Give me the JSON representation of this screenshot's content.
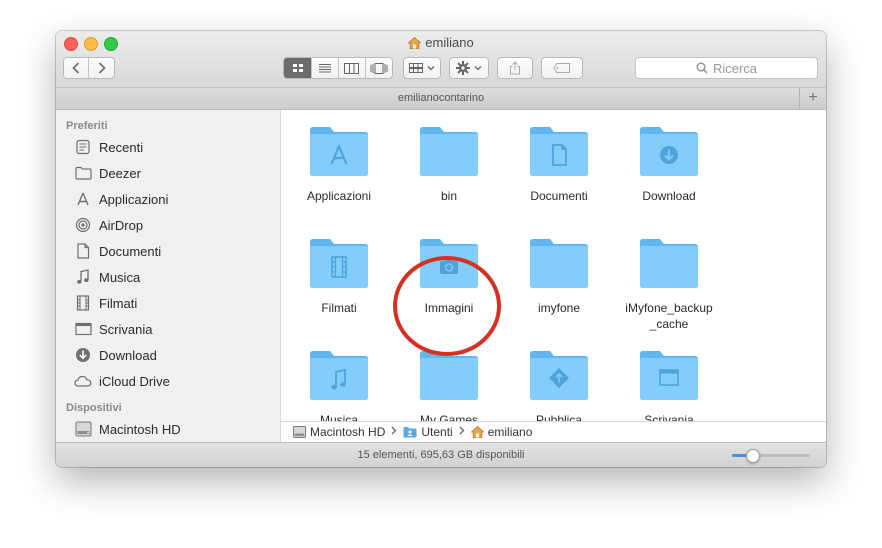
{
  "window": {
    "title": "emiliano",
    "path_header": "emilianocontarino"
  },
  "search": {
    "placeholder": "Ricerca"
  },
  "sidebar": {
    "favorites_header": "Preferiti",
    "favorites": [
      {
        "label": "Recenti",
        "icon": "clock-icon"
      },
      {
        "label": "Deezer",
        "icon": "folder-icon"
      },
      {
        "label": "Applicazioni",
        "icon": "applications-icon"
      },
      {
        "label": "AirDrop",
        "icon": "airdrop-icon"
      },
      {
        "label": "Documenti",
        "icon": "document-icon"
      },
      {
        "label": "Musica",
        "icon": "music-note-icon"
      },
      {
        "label": "Filmati",
        "icon": "film-icon"
      },
      {
        "label": "Scrivania",
        "icon": "desktop-icon"
      },
      {
        "label": "Download",
        "icon": "download-icon"
      },
      {
        "label": "iCloud Drive",
        "icon": "cloud-icon"
      }
    ],
    "devices_header": "Dispositivi",
    "devices": [
      {
        "label": "Macintosh HD",
        "icon": "hard-drive-icon"
      }
    ]
  },
  "files": [
    {
      "label": "Applicazioni",
      "icon": "applications-folder-icon"
    },
    {
      "label": "bin",
      "icon": "folder-icon"
    },
    {
      "label": "Documenti",
      "icon": "documents-folder-icon"
    },
    {
      "label": "Download",
      "icon": "downloads-folder-icon"
    },
    {
      "label": "Filmati",
      "icon": "movies-folder-icon"
    },
    {
      "label": "Immagini",
      "icon": "pictures-folder-icon"
    },
    {
      "label": "imyfone",
      "icon": "folder-icon"
    },
    {
      "label": "iMyfone_backup_cache",
      "icon": "folder-icon"
    },
    {
      "label": "Musica",
      "icon": "music-folder-icon"
    },
    {
      "label": "My Games",
      "icon": "folder-icon"
    },
    {
      "label": "Pubblica",
      "icon": "public-folder-icon"
    },
    {
      "label": "Scrivania",
      "icon": "desktop-folder-icon"
    }
  ],
  "breadcrumb": [
    "Macintosh HD",
    "Utenti",
    "emiliano"
  ],
  "status": {
    "text": "15 elementi, 695,63 GB disponibili"
  },
  "zoom": {
    "value": 0.25
  },
  "colors": {
    "folder": "#6ec0f5",
    "highlight_circle": "#d63025",
    "accent": "#4a90e2"
  }
}
